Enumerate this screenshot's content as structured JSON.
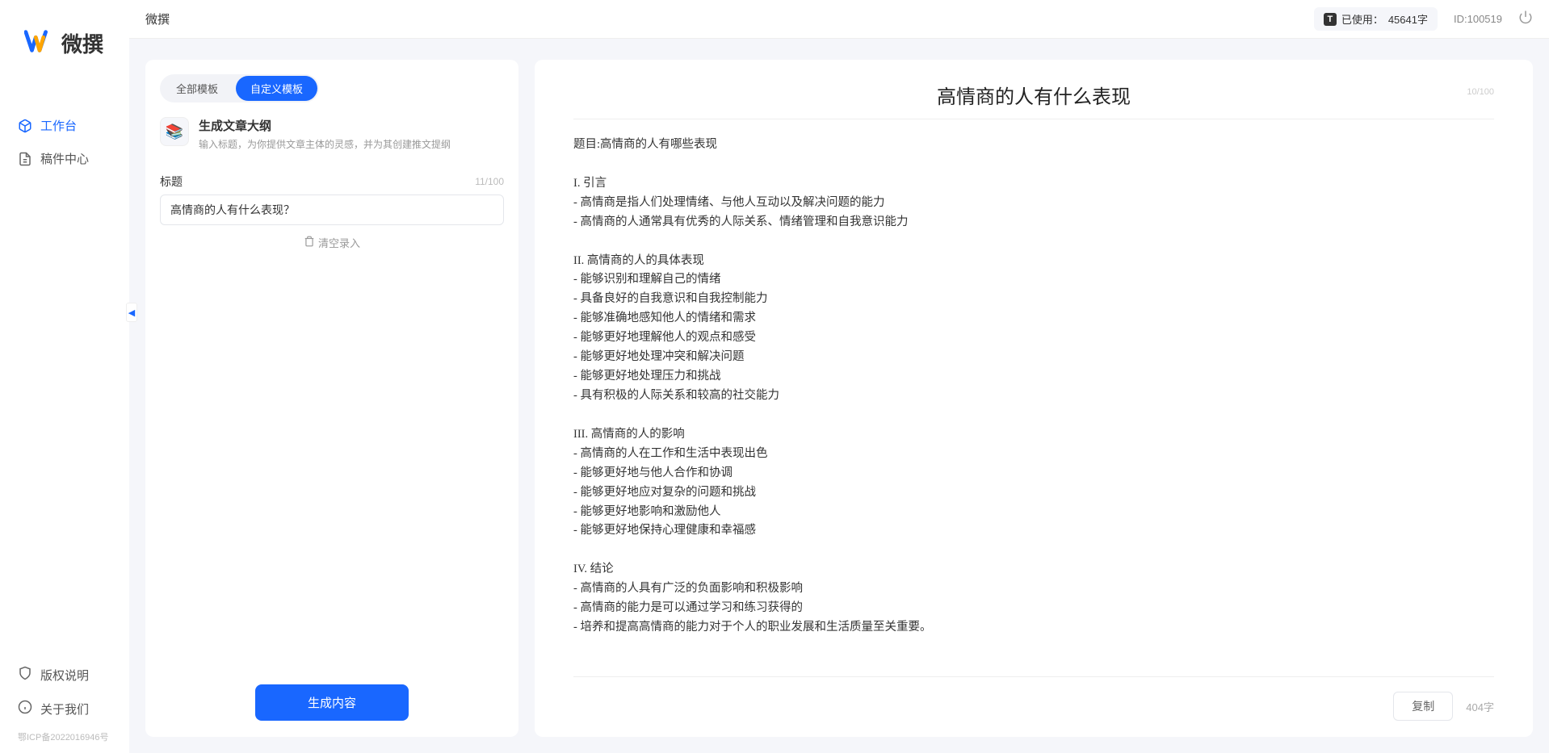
{
  "app": {
    "logoText": "微撰",
    "pageTitle": "微撰"
  },
  "nav": {
    "workspace": "工作台",
    "drafts": "稿件中心"
  },
  "sidebarBottom": {
    "copyright": "版权说明",
    "about": "关于我们",
    "icp": "鄂ICP备2022016946号"
  },
  "topbar": {
    "usageLabel": "已使用：",
    "usageValue": "45641字",
    "usageBadge": "T",
    "idLabel": "ID:",
    "idValue": "100519"
  },
  "tabs": {
    "all": "全部模板",
    "custom": "自定义模板"
  },
  "template": {
    "title": "生成文章大纲",
    "desc": "输入标题，为你提供文章主体的灵感，并为其创建推文提纲"
  },
  "form": {
    "titleLabel": "标题",
    "titleValue": "高情商的人有什么表现？",
    "titleCount": "11/100",
    "clearLabel": "清空录入",
    "generateLabel": "生成内容"
  },
  "output": {
    "title": "高情商的人有什么表现",
    "titleCount": "10/100",
    "body": "题目:高情商的人有哪些表现\n\nI. 引言\n- 高情商是指人们处理情绪、与他人互动以及解决问题的能力\n- 高情商的人通常具有优秀的人际关系、情绪管理和自我意识能力\n\nII. 高情商的人的具体表现\n- 能够识别和理解自己的情绪\n- 具备良好的自我意识和自我控制能力\n- 能够准确地感知他人的情绪和需求\n- 能够更好地理解他人的观点和感受\n- 能够更好地处理冲突和解决问题\n- 能够更好地处理压力和挑战\n- 具有积极的人际关系和较高的社交能力\n\nIII. 高情商的人的影响\n- 高情商的人在工作和生活中表现出色\n- 能够更好地与他人合作和协调\n- 能够更好地应对复杂的问题和挑战\n- 能够更好地影响和激励他人\n- 能够更好地保持心理健康和幸福感\n\nIV. 结论\n- 高情商的人具有广泛的负面影响和积极影响\n- 高情商的能力是可以通过学习和练习获得的\n- 培养和提高高情商的能力对于个人的职业发展和生活质量至关重要。",
    "copyLabel": "复制",
    "wordCount": "404字"
  }
}
